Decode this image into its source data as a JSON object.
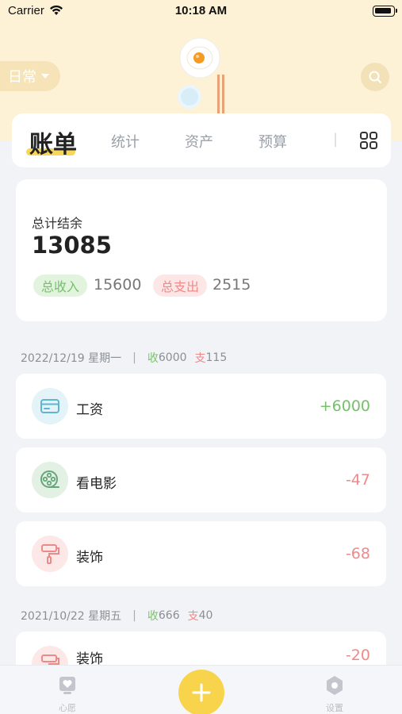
{
  "status": {
    "carrier": "Carrier",
    "time": "10:18 AM"
  },
  "header": {
    "mode": "日常"
  },
  "tabs": {
    "active": "账单",
    "items": [
      "统计",
      "资产",
      "预算"
    ]
  },
  "summary": {
    "balance_label": "总计结余",
    "balance": "13085",
    "income_label": "总收入",
    "income": "15600",
    "expense_label": "总支出",
    "expense": "2515"
  },
  "days": [
    {
      "date": "2022/12/19 星期一",
      "income_label": "收",
      "income": "6000",
      "expense_label": "支",
      "expense": "115",
      "records": [
        {
          "name": "工资",
          "amount": "+6000",
          "icon": "wallet-icon"
        },
        {
          "name": "看电影",
          "amount": "-47",
          "icon": "film-reel-icon"
        },
        {
          "name": "装饰",
          "amount": "-68",
          "icon": "paint-roller-icon"
        }
      ]
    },
    {
      "date": "2021/10/22 星期五",
      "income_label": "收",
      "income": "666",
      "expense_label": "支",
      "expense": "40",
      "records": [
        {
          "name": "装饰",
          "amount": "-20",
          "icon": "paint-roller-icon"
        }
      ]
    }
  ],
  "bottom_nav": {
    "left": "心愿",
    "right": "设置"
  },
  "colors": {
    "accent": "#f8d44d",
    "income": "#74c16a",
    "expense": "#ee8a8a",
    "header_bg": "#fdf1d6"
  }
}
